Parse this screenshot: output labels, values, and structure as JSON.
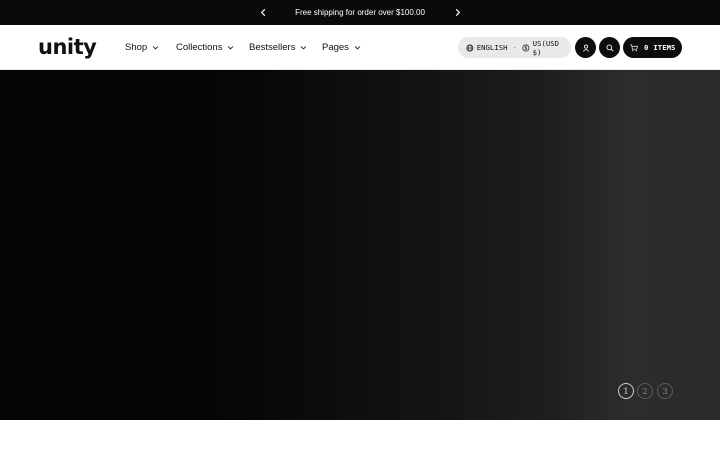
{
  "announcement": {
    "message": "Free shipping for order over $100.00",
    "prev_icon": "chevron-left-icon",
    "next_icon": "chevron-right-icon"
  },
  "header": {
    "logo": "unity",
    "nav": [
      {
        "label": "Shop"
      },
      {
        "label": "Collections"
      },
      {
        "label": "Bestsellers"
      },
      {
        "label": "Pages"
      }
    ],
    "locale": {
      "language": "ENGLISH",
      "separator": "-",
      "currency": "US(USD $)"
    },
    "cart": {
      "count": "0",
      "label": "ITEMS"
    }
  },
  "hero": {
    "slides": [
      "1",
      "2",
      "3"
    ],
    "active_slide": "1"
  },
  "colors": {
    "bar": "#0a0a0a",
    "button": "#0d0d0d",
    "pill": "#e9e9e9"
  }
}
